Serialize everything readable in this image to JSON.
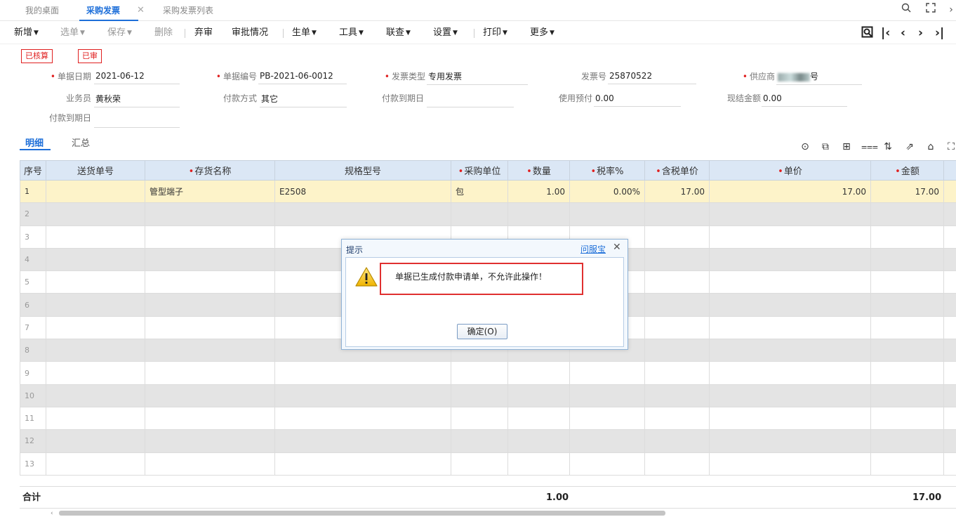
{
  "tabs": [
    {
      "label": "我的桌面"
    },
    {
      "label": "采购发票",
      "active": true
    },
    {
      "label": "采购发票列表"
    }
  ],
  "window": {
    "search_icon": "search-icon",
    "fullscreen_icon": "fullscreen-icon"
  },
  "toolbar": {
    "new": "新增",
    "select": "选单",
    "save": "保存",
    "delete": "删除",
    "abandon": "弃审",
    "approval": "审批情况",
    "generate": "生单",
    "tools": "工具",
    "query": "联查",
    "settings": "设置",
    "print": "打印",
    "more": "更多"
  },
  "stamps": {
    "verified": "已核算",
    "approved": "已审"
  },
  "form": {
    "doc_date_label": "单据日期",
    "doc_date": "2021-06-12",
    "doc_no_label": "单据编号",
    "doc_no": "PB-2021-06-0012",
    "invoice_type_label": "发票类型",
    "invoice_type": "专用发票",
    "invoice_no_label": "发票号",
    "invoice_no": "25870522",
    "supplier_label": "供应商",
    "supplier": "号",
    "salesman_label": "业务员",
    "salesman": "黄秋荣",
    "pay_method_label": "付款方式",
    "pay_method": "其它",
    "due_date_label": "付款到期日",
    "due_date": "",
    "prepay_label": "使用预付",
    "prepay": "0.00",
    "cash_label": "现结金额",
    "cash": "0.00",
    "due_date2_label": "付款到期日",
    "due_date2": ""
  },
  "subtabs": {
    "detail": "明细",
    "summary": "汇总"
  },
  "grid": {
    "headers": [
      "序号",
      "送货单号",
      "存货名称",
      "规格型号",
      "采购单位",
      "数量",
      "税率%",
      "含税单价",
      "单价",
      "金额"
    ],
    "rows": [
      {
        "seq": "1",
        "delivery": "",
        "name": "管型端子",
        "spec": "E2508",
        "unit": "包",
        "qty": "1.00",
        "tax": "0.00%",
        "price_tax": "17.00",
        "price": "17.00",
        "amount": "17.00"
      },
      {
        "seq": "2"
      },
      {
        "seq": "3"
      },
      {
        "seq": "4"
      },
      {
        "seq": "5"
      },
      {
        "seq": "6"
      },
      {
        "seq": "7"
      },
      {
        "seq": "8"
      },
      {
        "seq": "9"
      },
      {
        "seq": "10"
      },
      {
        "seq": "11"
      },
      {
        "seq": "12"
      },
      {
        "seq": "13"
      }
    ]
  },
  "totals": {
    "label": "合计",
    "qty": "1.00",
    "amount": "17.00"
  },
  "dialog": {
    "title": "提示",
    "help": "问服宝",
    "message": "单据已生成付款申请单，不允许此操作！",
    "ok": "确定(O)"
  },
  "colors": {
    "accent": "#1e6fd9",
    "stamp": "#e02020",
    "header_bg": "#dbe7f5",
    "selected_row": "#fdf3c9"
  }
}
